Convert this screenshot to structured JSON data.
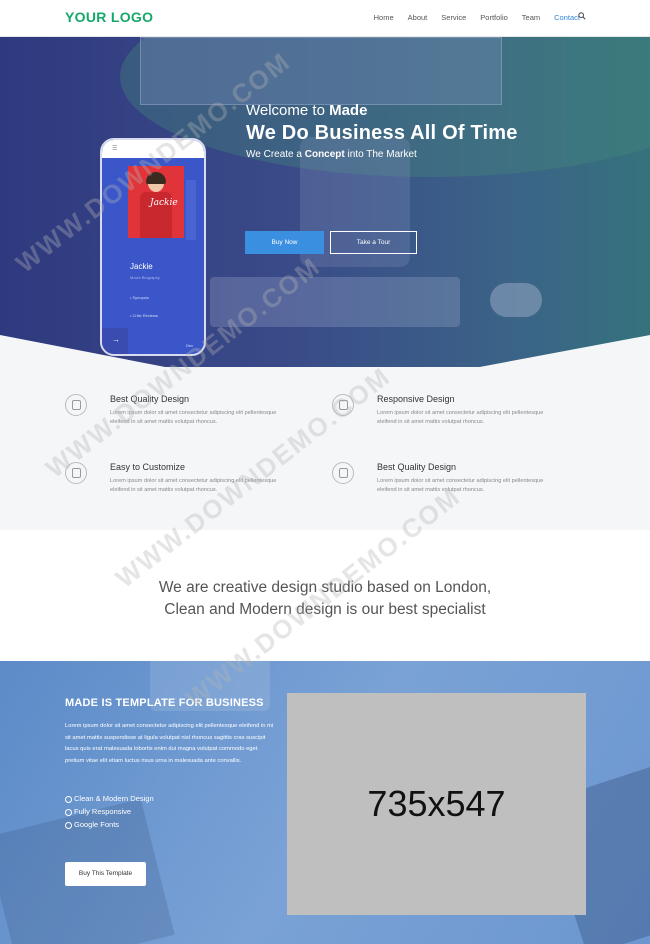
{
  "nav": {
    "logo": "YOUR LOGO",
    "items": [
      "Home",
      "About",
      "Service",
      "Portfolio",
      "Team",
      "Contact"
    ],
    "active": "Contact",
    "search_icon": "search-icon"
  },
  "hero": {
    "welcome_prefix": "Welcome to ",
    "welcome_brand": "Made",
    "title": "We Do Business All Of Time",
    "sub_prefix": "We Create a ",
    "sub_bold": "Concept",
    "sub_suffix": " into The Market",
    "buy_label": "Buy Now",
    "tour_label": "Take a Tour"
  },
  "phone": {
    "name": "Jackie",
    "role": "Movie Biography",
    "row1": "Synopsis",
    "row2": "Critic Reviews",
    "signature": "Jackie",
    "corner": "Dec"
  },
  "features": [
    {
      "title": "Best Quality Design",
      "text": "Lorem ipsum dolor sit amet consectetur adipiscing elit pellentesque eleifend in sit amet mattis volutpat rhoncus.",
      "icon": "brush-icon"
    },
    {
      "title": "Responsive Design",
      "text": "Lorem ipsum dolor sit amet consectetur adipiscing elit pellentesque eleifend in sit amet mattis volutpat rhoncus.",
      "icon": "monitor-icon"
    },
    {
      "title": "Easy to Customize",
      "text": "Lorem ipsum dolor sit amet consectetur adipiscing elit pellentesque eleifend in sit amet mattis volutpat rhoncus.",
      "icon": "settings-icon"
    },
    {
      "title": "Best Quality Design",
      "text": "Lorem ipsum dolor sit amet consectetur adipiscing elit pellentesque eleifend in sit amet mattis volutpat rhoncus.",
      "icon": "mobile-icon"
    }
  ],
  "tagline": {
    "line1": "We are creative design studio based on London,",
    "line2": "Clean and Modern design is our best specialist"
  },
  "template_section": {
    "title": "MADE IS TEMPLATE FOR BUSINESS",
    "paragraph": "Lorem ipsum dolor sit amet consectetur adipiscing elit pellentesque eleifend in mi sit amet mattis suspendisse at ligula volutpat nisl rhoncus sagittis cras suscipit lacus quis erat malesuada lobortis enim dui magna volutpat commodo eget pretium vitae elit etiam luctus risus urna in malesuada ante convallis.",
    "list": [
      "Clean & Modern Design",
      "Fully Responsive",
      "Google Fonts"
    ],
    "button_label": "Buy This Template",
    "placeholder_text": "735x547"
  },
  "watermark": "WWW.DOWNDEMO.COM",
  "colors": {
    "logo": "#14a86b",
    "active_nav": "#2f86d6",
    "primary_button": "#3b8fe0",
    "hero": "#2f397f",
    "blue_section": "#6b96cf"
  }
}
